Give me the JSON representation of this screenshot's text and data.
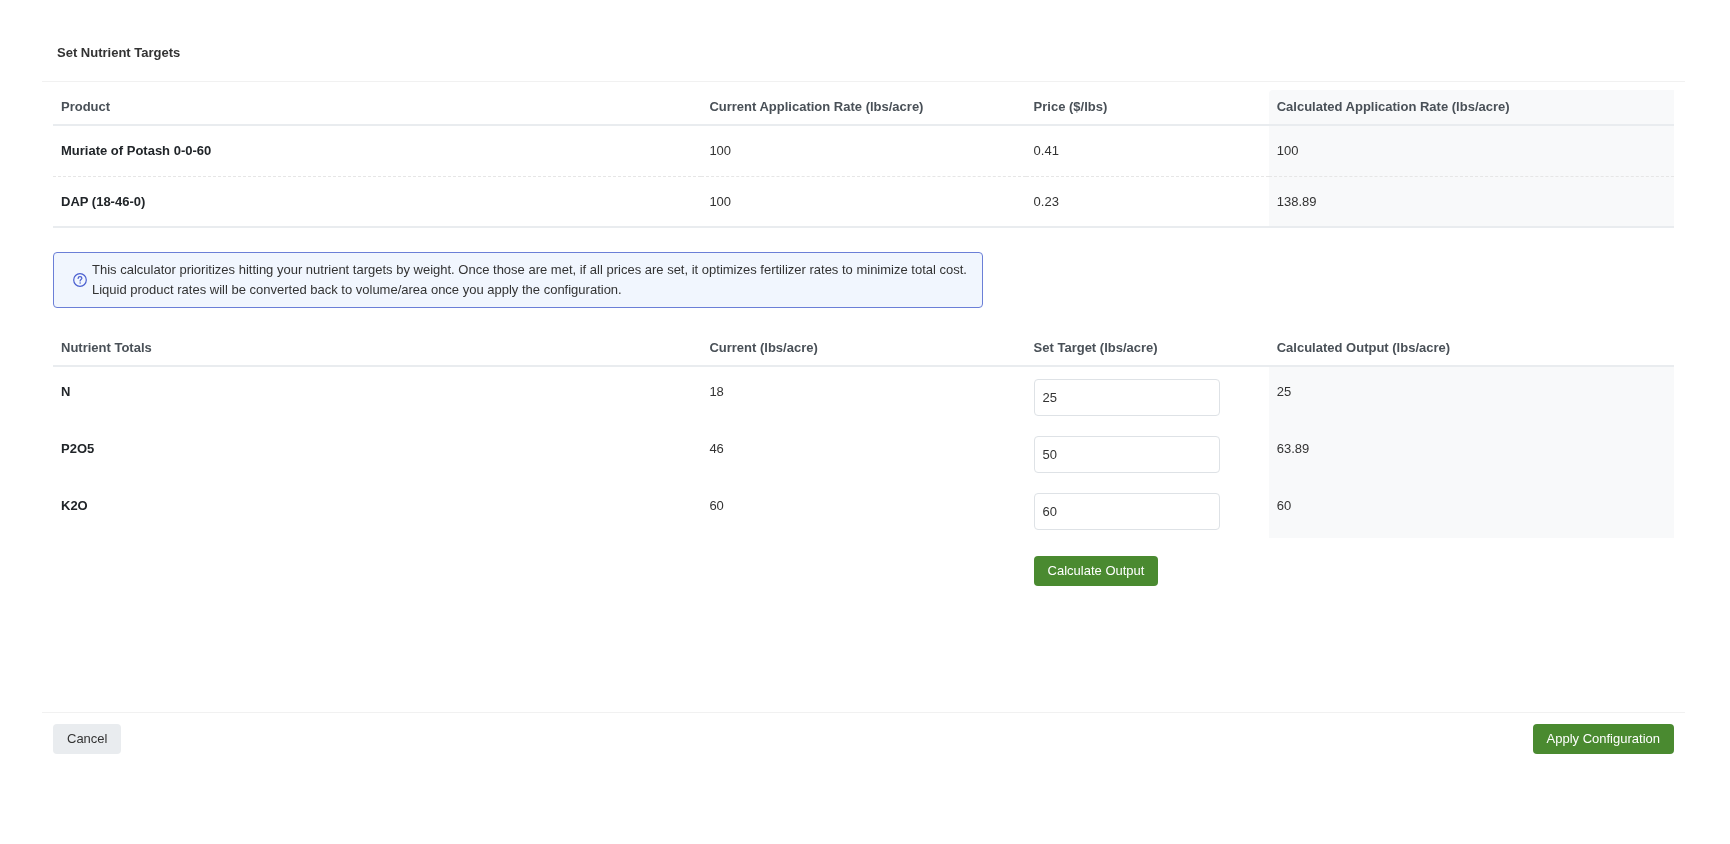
{
  "dialog": {
    "title": "Set Nutrient Targets"
  },
  "products_table": {
    "columns": [
      "Product",
      "Current Application Rate (lbs/acre)",
      "Price ($/lbs)",
      "Calculated Application Rate (lbs/acre)"
    ],
    "rows": [
      {
        "product": "Muriate of Potash 0-0-60",
        "current_rate": "100",
        "price": "0.41",
        "calculated_rate": "100"
      },
      {
        "product": "DAP (18-46-0)",
        "current_rate": "100",
        "price": "0.23",
        "calculated_rate": "138.89"
      }
    ]
  },
  "info_note": {
    "lines": [
      "This calculator prioritizes hitting your nutrient targets by weight. Once those are met, if all prices are set, it optimizes fertilizer rates to minimize total cost.",
      "Liquid product rates will be converted back to volume/area once you apply the configuration."
    ]
  },
  "nutrient_table": {
    "columns": [
      "Nutrient Totals",
      "Current (lbs/acre)",
      "Set Target (lbs/acre)",
      "Calculated Output (lbs/acre)"
    ],
    "rows": [
      {
        "nutrient": "N",
        "current": "18",
        "target": "25",
        "calculated_output": "25"
      },
      {
        "nutrient": "P2O5",
        "current": "46",
        "target": "50",
        "calculated_output": "63.89"
      },
      {
        "nutrient": "K2O",
        "current": "60",
        "target": "60",
        "calculated_output": "60"
      }
    ],
    "calculate_button": "Calculate Output"
  },
  "footer": {
    "buttons": [
      {
        "label": "Cancel",
        "kind": "secondary"
      },
      {
        "label": "Apply Configuration",
        "kind": "primary"
      }
    ]
  }
}
